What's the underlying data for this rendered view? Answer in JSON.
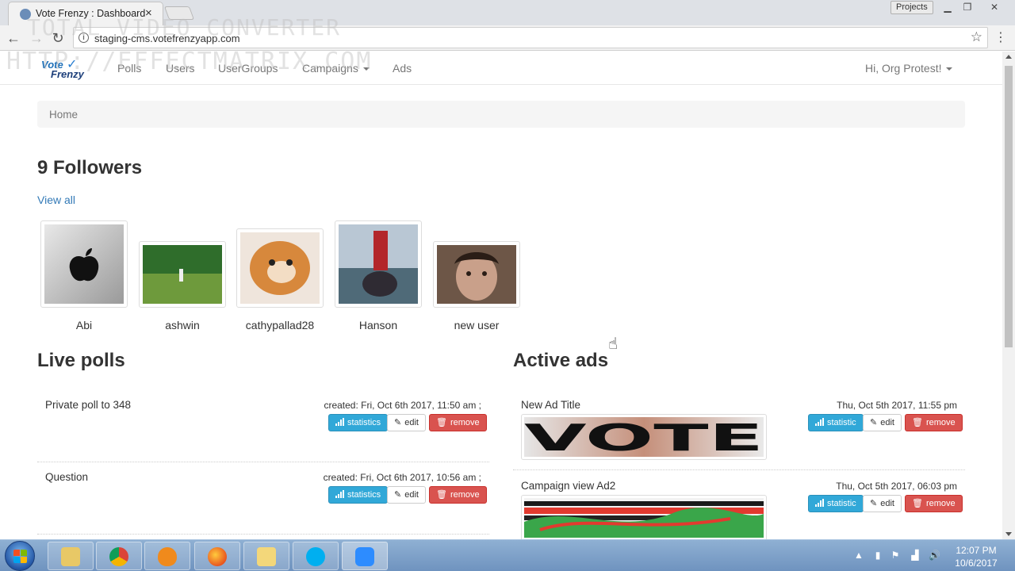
{
  "browser": {
    "tab_title": "Vote Frenzy : Dashboard",
    "tab_close": "×",
    "projects_label": "Projects",
    "url": "staging-cms.votefrenzyapp.com"
  },
  "watermark": {
    "line1": "TOTAL VIDEO CONVERTER",
    "line2": "HTTP://EFFECTMATRIX.COM"
  },
  "navbar": {
    "logo_line1": "Vote",
    "logo_line2": "Frenzy",
    "links": [
      "Polls",
      "Users",
      "UserGroups",
      "Campaigns",
      "Ads"
    ],
    "user_menu": "Hi, Org Protest!"
  },
  "breadcrumb": {
    "home": "Home"
  },
  "followers": {
    "title": "9 Followers",
    "view_all": "View all",
    "items": [
      {
        "name": "Abi",
        "image": "apple-logo"
      },
      {
        "name": "ashwin",
        "image": "golf-course"
      },
      {
        "name": "cathypallad28",
        "image": "cat"
      },
      {
        "name": "Hanson",
        "image": "buoy"
      },
      {
        "name": "new user",
        "image": "man-portrait"
      }
    ]
  },
  "live_polls": {
    "title": "Live polls",
    "items": [
      {
        "question": "Private poll to 348",
        "created": "created: Fri, Oct 6th 2017, 11:50 am ;"
      },
      {
        "question": "Question",
        "created": "created: Fri, Oct 6th 2017, 10:56 am ;"
      }
    ],
    "buttons": {
      "statistics": "statistics",
      "edit": "edit",
      "remove": "remove"
    }
  },
  "active_ads": {
    "title": "Active ads",
    "items": [
      {
        "title": "New Ad Title",
        "date": "Thu, Oct 5th 2017, 11:55 pm",
        "image_text": "VOTE"
      },
      {
        "title": "Campaign view Ad2",
        "date": "Thu, Oct 5th 2017, 06:03 pm"
      }
    ],
    "buttons": {
      "statistic": "statistic",
      "edit": "edit",
      "remove": "remove"
    }
  },
  "taskbar": {
    "time": "12:07 PM",
    "date": "10/6/2017"
  },
  "colors": {
    "link": "#337ab7",
    "info_button": "#31a8d8",
    "danger_button": "#d9534f",
    "taskbar": "#7a9cc6"
  }
}
